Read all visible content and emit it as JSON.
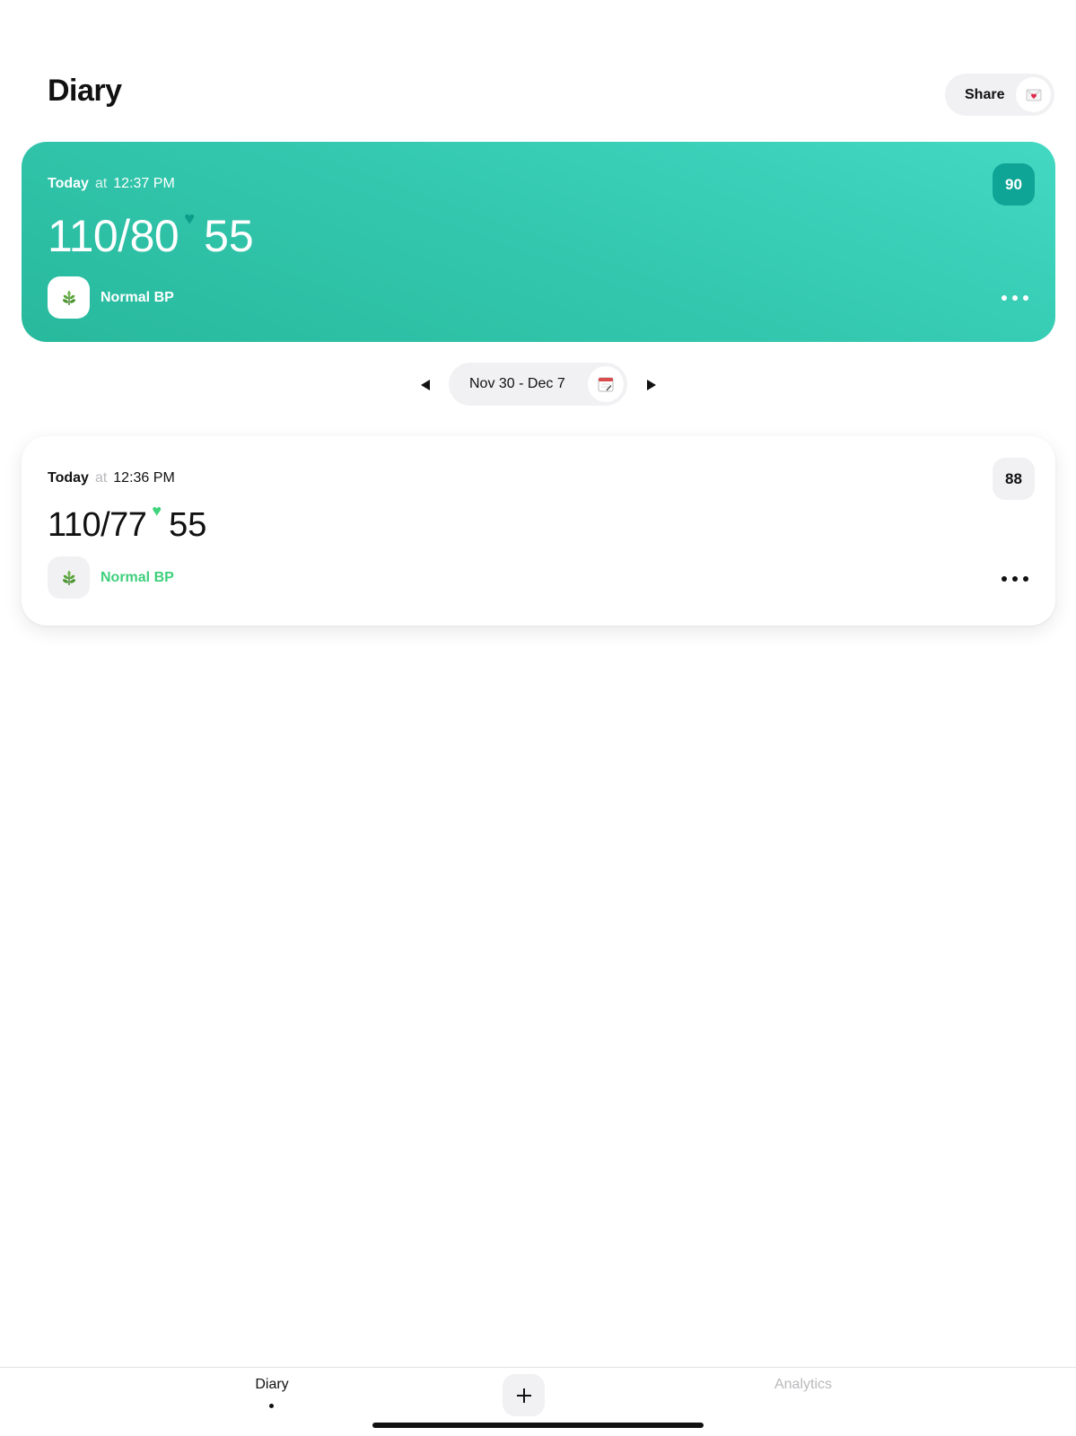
{
  "header": {
    "title": "Diary",
    "share_label": "Share",
    "share_icon": "envelope-heart-icon"
  },
  "entries": [
    {
      "day": "Today",
      "at": "at",
      "time": "12:37 PM",
      "bp": "110/80",
      "heart_rate": "55",
      "pulse": "90",
      "status": "Normal BP",
      "status_icon": "leaf-icon",
      "highlighted": true
    },
    {
      "day": "Today",
      "at": "at",
      "time": "12:36 PM",
      "bp": "110/77",
      "heart_rate": "55",
      "pulse": "88",
      "status": "Normal BP",
      "status_icon": "leaf-icon",
      "highlighted": false
    }
  ],
  "range": {
    "label": "Nov 30 - Dec 7",
    "calendar_icon": "calendar-icon"
  },
  "tabbar": {
    "diary_label": "Diary",
    "analytics_label": "Analytics",
    "add_icon": "plus-icon"
  },
  "colors": {
    "accent_teal": "#34c9b0",
    "badge_teal": "#0ea596",
    "normal_green": "#3dd07c"
  }
}
